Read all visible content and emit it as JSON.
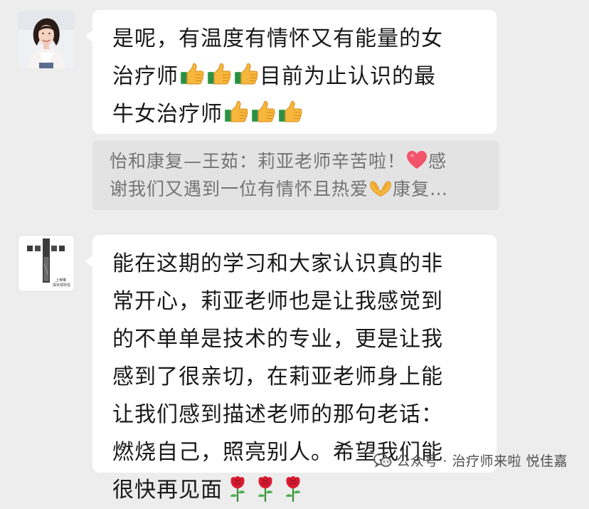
{
  "messages": [
    {
      "line1": "是呢，有温度有情怀又有能量的女",
      "line2_text": "治疗师",
      "line2_text_after": "目前为止认识的最",
      "line3_text": "牛女治疗师",
      "emoji": "thumbs-up-icon"
    },
    {
      "lines": [
        "能在这期的学习和大家认识真的非",
        "常开心，莉亚老师也是让我感觉到",
        "的不单单是技术的专业，更是让我",
        "感到了很亲切，在莉亚老师身上能",
        "让我们感到描述老师的那句老话：",
        "燃烧自己，照亮别人。希望我们能"
      ],
      "last_line": "很快再见面",
      "emoji": "rose-icon"
    }
  ],
  "quote": {
    "line1": "怡和康复—王茹：莉亚老师辛苦啦！",
    "line1_after": "感",
    "line2": "谢我们又遇到一位有情怀且热爱",
    "line2_after": "康复…"
  },
  "watermark": {
    "text": "公众号 · 治疗师来啦 悦佳嘉"
  },
  "avatar2": {
    "caption_line1": "上帝推",
    "caption_line2": "探本观夺信"
  },
  "colors": {
    "background": "#ededed",
    "bubble": "#ffffff",
    "quote_bg": "#e3e3e3",
    "quote_text": "#737373",
    "heart": "#f2546b",
    "thumb": "#f6b73c",
    "sleeve": "#3aa655",
    "rose": "#d81b30"
  }
}
